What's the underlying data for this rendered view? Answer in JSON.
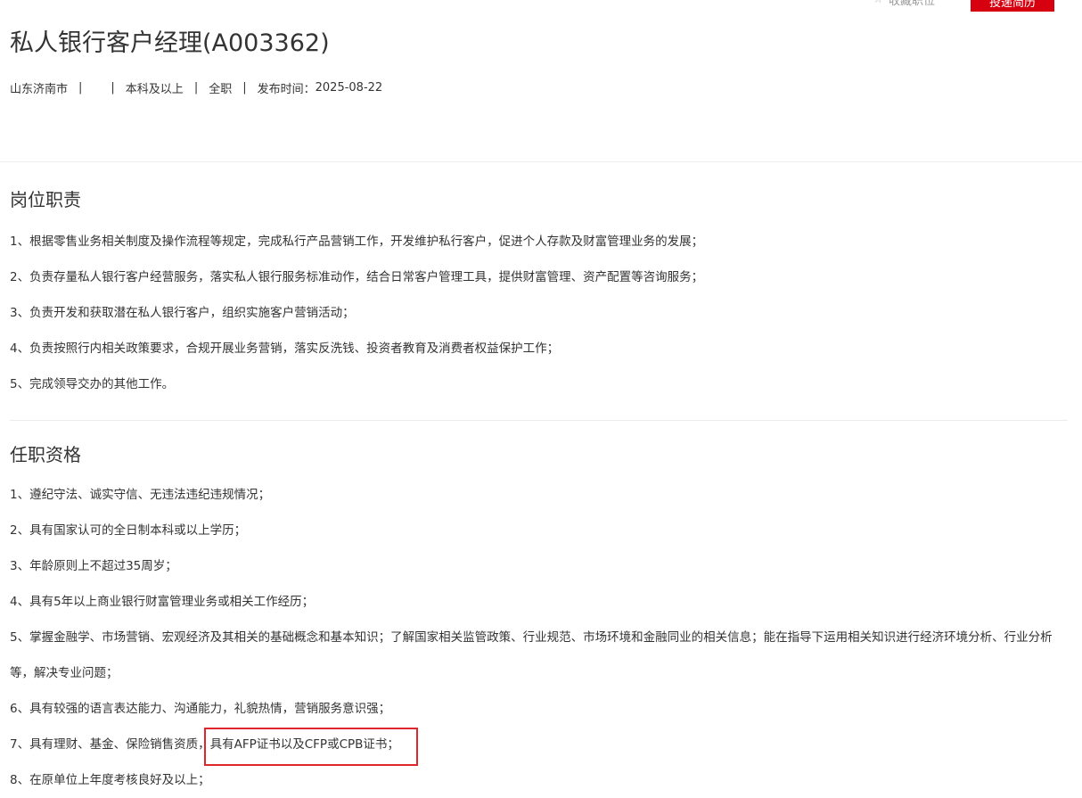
{
  "actions": {
    "favorite_label": "收藏职位",
    "apply_label": "投递简历"
  },
  "job": {
    "title": "私人银行客户经理(A003362)",
    "location": "山东济南市",
    "experience": "",
    "education": "本科及以上",
    "type": "全职",
    "publish_label": "发布时间：",
    "publish_date": "2025-08-22"
  },
  "separator": "|",
  "responsibilities": {
    "heading": "岗位职责",
    "items": [
      "1、根据零售业务相关制度及操作流程等规定，完成私行产品营销工作，开发维护私行客户，促进个人存款及财富管理业务的发展；",
      "2、负责存量私人银行客户经营服务，落实私人银行服务标准动作，结合日常客户管理工具，提供财富管理、资产配置等咨询服务；",
      "3、负责开发和获取潜在私人银行客户，组织实施客户营销活动；",
      "4、负责按照行内相关政策要求，合规开展业务营销，落实反洗钱、投资者教育及消费者权益保护工作；",
      "5、完成领导交办的其他工作。"
    ]
  },
  "qualifications": {
    "heading": "任职资格",
    "items": [
      "1、遵纪守法、诚实守信、无违法违纪违规情况；",
      "2、具有国家认可的全日制本科或以上学历；",
      "3、年龄原则上不超过35周岁；",
      "4、具有5年以上商业银行财富管理业务或相关工作经历；",
      "5、掌握金融学、市场营销、宏观经济及其相关的基础概念和基本知识；了解国家相关监管政策、行业规范、市场环境和金融同业的相关信息；能在指导下运用相关知识进行经济环境分析、行业分析等，解决专业问题；",
      "6、具有较强的语言表达能力、沟通能力，礼貌热情，营销服务意识强；"
    ],
    "item7_prefix": "7、具有理财、基金、保险销售资质，",
    "item7_highlight": "具有AFP证书以及CFP或CPB证书；",
    "item8": "8、在原单位上年度考核良好及以上；"
  }
}
